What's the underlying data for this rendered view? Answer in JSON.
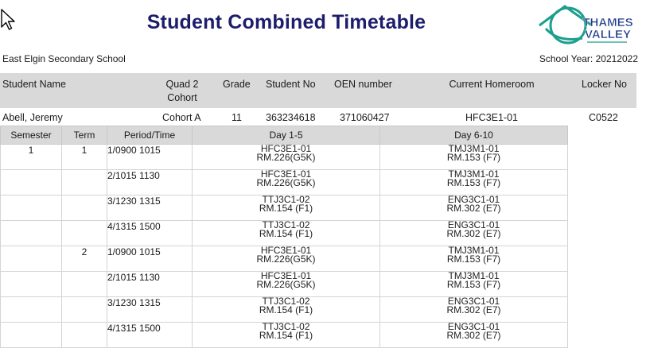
{
  "title": "Student Combined Timetable",
  "logo": {
    "line1": "THAMES",
    "line2": "VALLEY"
  },
  "school_name": "East Elgin Secondary School",
  "school_year": "School Year: 20212022",
  "student_headers": {
    "name": "Student Name",
    "cohort": "Quad 2 Cohort",
    "grade": "Grade",
    "student_no": "Student No",
    "oen": "OEN number",
    "homeroom": "Current Homeroom",
    "locker": "Locker No"
  },
  "student": {
    "name": "Abell, Jeremy",
    "cohort": "Cohort A",
    "grade": "11",
    "student_no": "363234618",
    "oen": "371060427",
    "homeroom": "HFC3E1-01",
    "locker": "C0522"
  },
  "timetable_headers": {
    "semester": "Semester",
    "term": "Term",
    "period": "Period/Time",
    "day1": "Day 1-5",
    "day2": "Day 6-10"
  },
  "rows": [
    {
      "semester": "1",
      "term": "1",
      "period": "1/0900 1015",
      "d1_course": "HFC3E1-01",
      "d1_room": "RM.226(G5K)",
      "d2_course": "TMJ3M1-01",
      "d2_room": "RM.153 (F7)"
    },
    {
      "semester": "",
      "term": "",
      "period": "2/1015 1130",
      "d1_course": "HFC3E1-01",
      "d1_room": "RM.226(G5K)",
      "d2_course": "TMJ3M1-01",
      "d2_room": "RM.153 (F7)"
    },
    {
      "semester": "",
      "term": "",
      "period": "3/1230 1315",
      "d1_course": "TTJ3C1-02",
      "d1_room": "RM.154 (F1)",
      "d2_course": "ENG3C1-01",
      "d2_room": "RM.302 (E7)"
    },
    {
      "semester": "",
      "term": "",
      "period": "4/1315 1500",
      "d1_course": "TTJ3C1-02",
      "d1_room": "RM.154 (F1)",
      "d2_course": "ENG3C1-01",
      "d2_room": "RM.302 (E7)"
    },
    {
      "semester": "",
      "term": "2",
      "period": "1/0900 1015",
      "d1_course": "HFC3E1-01",
      "d1_room": "RM.226(G5K)",
      "d2_course": "TMJ3M1-01",
      "d2_room": "RM.153 (F7)"
    },
    {
      "semester": "",
      "term": "",
      "period": "2/1015 1130",
      "d1_course": "HFC3E1-01",
      "d1_room": "RM.226(G5K)",
      "d2_course": "TMJ3M1-01",
      "d2_room": "RM.153 (F7)"
    },
    {
      "semester": "",
      "term": "",
      "period": "3/1230 1315",
      "d1_course": "TTJ3C1-02",
      "d1_room": "RM.154 (F1)",
      "d2_course": "ENG3C1-01",
      "d2_room": "RM.302 (E7)"
    },
    {
      "semester": "",
      "term": "",
      "period": "4/1315 1500",
      "d1_course": "TTJ3C1-02",
      "d1_room": "RM.154 (F1)",
      "d2_course": "ENG3C1-01",
      "d2_room": "RM.302 (E7)"
    }
  ]
}
